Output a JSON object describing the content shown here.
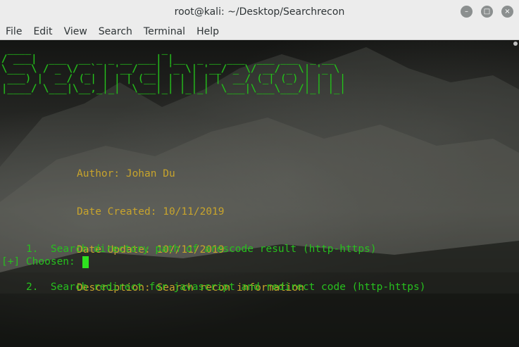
{
  "window": {
    "title": "root@kali: ~/Desktop/Searchrecon",
    "controls": {
      "minimize": "–",
      "maximize": "□",
      "close": "×"
    }
  },
  "menu": [
    "File",
    "Edit",
    "View",
    "Search",
    "Terminal",
    "Help"
  ],
  "banner_text": "Searchrecon",
  "banner_ascii": [
    " ____                      _                           ",
    "/ ___|  ___  __ _ _ __ ___| |__  _ __ ___  ___ ___  _ __",
    "\\___ \\ / _ \\/ _` | '__/ __| '_ \\| '__/ _ \\/ __/ _ \\| '_ \\",
    " ___) |  __/ (_| | | | (__| | | | | |  __/ (_| (_) | | | |",
    "|____/ \\___|\\__,_|_|  \\___|_| |_|_|  \\___|\\___\\___/|_| |_|"
  ],
  "info": {
    "author": "Author: Johan Du",
    "created": "Date Created: 10/11/2019",
    "updated": "Date Update: 10//11/2019",
    "description": "Description: Search recon information"
  },
  "options": [
    "1.  Search directory path of arescode result (http-https)",
    "2.  Search redirect for javascript and redirect code (http-https)"
  ],
  "prompt": "[+] Choosen: ",
  "colors": {
    "green": "#27c01e",
    "yellow": "#c8a42c",
    "cursor": "#2ee21f"
  }
}
